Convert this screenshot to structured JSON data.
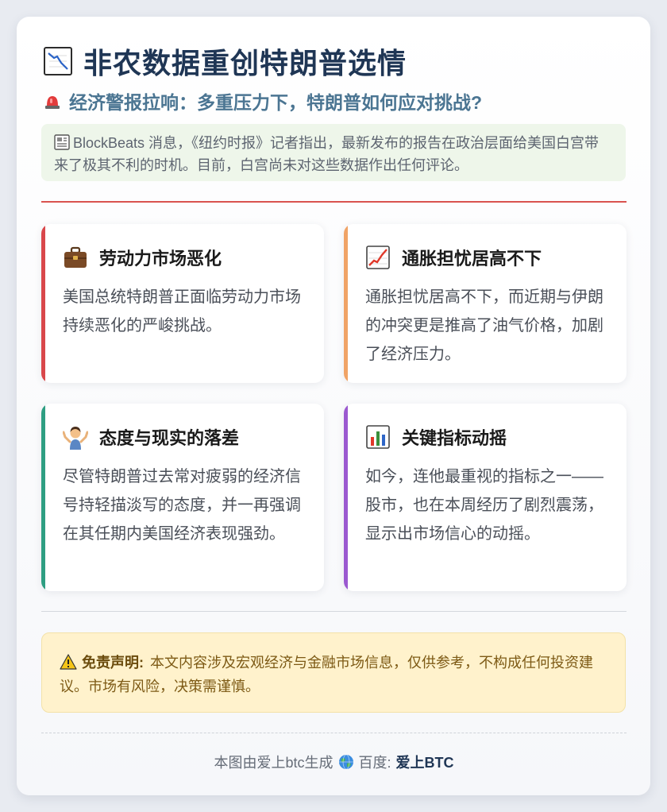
{
  "header": {
    "title": "非农数据重创特朗普选情",
    "title_icon": "chart-decreasing-icon",
    "subtitle": "经济警报拉响：多重压力下，特朗普如何应对挑战?",
    "subtitle_icon": "siren-icon"
  },
  "intro": {
    "icon": "newspaper-icon",
    "text": "BlockBeats 消息，《纽约时报》记者指出，最新发布的报告在政治层面给美国白宫带来了极其不利的时机。目前，白宫尚未对这些数据作出任何评论。"
  },
  "topics": [
    {
      "icon": "briefcase-icon",
      "title": "劳动力市场恶化",
      "body": "美国总统特朗普正面临劳动力市场持续恶化的严峻挑战。",
      "accent": "#d9474b"
    },
    {
      "icon": "chart-increasing-icon",
      "title": "通胀担忧居高不下",
      "body": "通胀担忧居高不下，而近期与伊朗的冲突更是推高了油气价格，加剧了经济压力。",
      "accent": "#f0a366"
    },
    {
      "icon": "person-shrugging-icon",
      "title": "态度与现实的落差",
      "body": "尽管特朗普过去常对疲弱的经济信号持轻描淡写的态度，并一再强调在其任期内美国经济表现强劲。",
      "accent": "#2e9e82"
    },
    {
      "icon": "bar-chart-icon",
      "title": "关键指标动摇",
      "body": "如今，连他最重视的指标之一——股市，也在本周经历了剧烈震荡，显示出市场信心的动摇。",
      "accent": "#9b59d0"
    }
  ],
  "disclaimer": {
    "icon": "warning-icon",
    "label": "免责声明:",
    "text": "本文内容涉及宏观经济与金融市场信息，仅供参考，不构成任何投资建议。市场有风险，决策需谨慎。"
  },
  "footer": {
    "text": "本图由爱上btc生成",
    "globe_icon": "globe-icon",
    "baidu_label": "百度:",
    "brand": "爱上BTC"
  }
}
